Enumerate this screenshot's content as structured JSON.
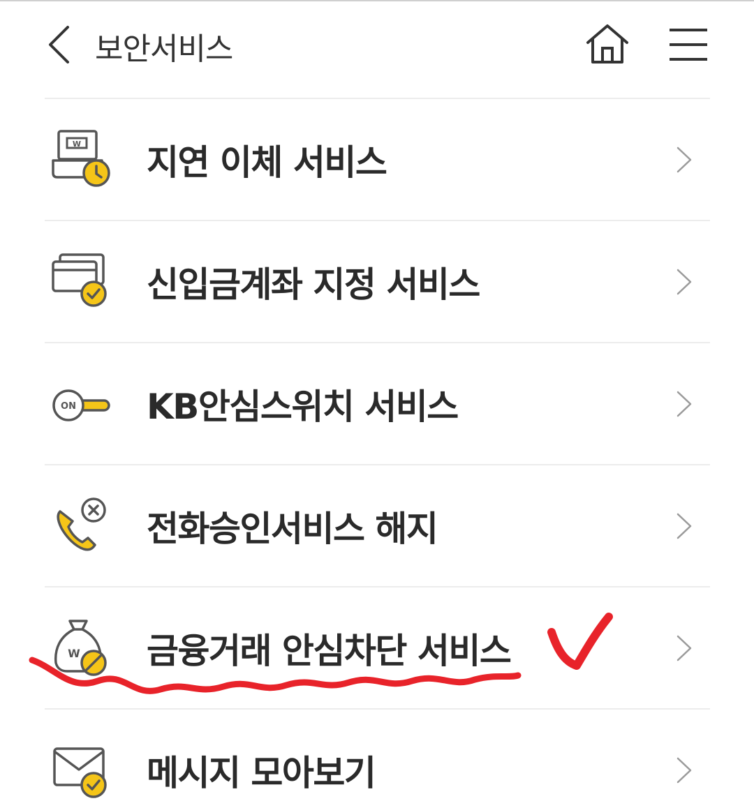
{
  "header": {
    "title": "보안서비스",
    "back_icon": "chevron-left-icon",
    "home_icon": "home-icon",
    "menu_icon": "hamburger-menu-icon"
  },
  "colors": {
    "accent": "#F5C518",
    "icon_stroke": "#555555",
    "divider": "#ECECEC",
    "annotation": "#E8232A"
  },
  "items": [
    {
      "label": "지연 이체 서비스",
      "icon": "delayed-transfer-clock-icon"
    },
    {
      "label": "신입금계좌 지정 서비스",
      "icon": "card-check-icon"
    },
    {
      "label": "KB안심스위치 서비스",
      "icon": "on-switch-key-icon"
    },
    {
      "label": "전화승인서비스 해지",
      "icon": "phone-cancel-icon"
    },
    {
      "label": "금융거래 안심차단 서비스",
      "icon": "money-bag-block-icon"
    },
    {
      "label": "메시지 모아보기",
      "icon": "envelope-check-icon"
    }
  ],
  "annotation": {
    "checkmark": "red-handwritten-checkmark",
    "underline": "red-wavy-underline",
    "marks_item": "금융거래 안심차단 서비스"
  }
}
